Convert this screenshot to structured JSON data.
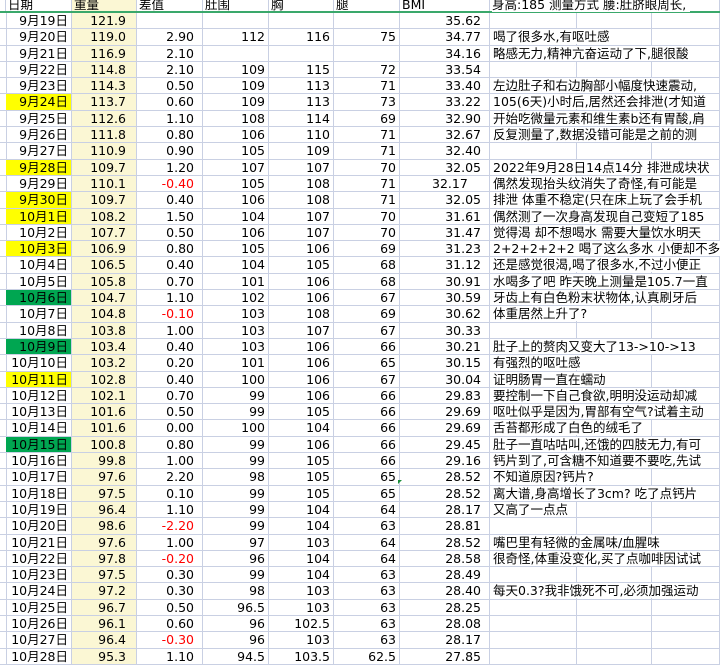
{
  "header": {
    "date": "日期",
    "weight": "重量",
    "diff": "差值",
    "belly": "肚围",
    "chest": "胸",
    "leg": "腿",
    "bmi": "BMI",
    "notes": "身高:185  测量方式  腰:肚脐眼周长,"
  },
  "colors": {
    "yellow": "#ffff00",
    "green": "#00a651",
    "weight_col": "#fbf7d4",
    "negative": "#ff0000"
  },
  "rows": [
    {
      "date": "9月19日",
      "weight": "121.9",
      "diff": "",
      "belly": "",
      "chest": "",
      "leg": "",
      "bmi": "35.62",
      "note": "",
      "hl": ""
    },
    {
      "date": "9月20日",
      "weight": "119.0",
      "diff": "2.90",
      "belly": "112",
      "chest": "116",
      "leg": "75",
      "bmi": "34.77",
      "note": "喝了很多水,有呕吐感",
      "hl": ""
    },
    {
      "date": "9月21日",
      "weight": "116.9",
      "diff": "2.10",
      "belly": "",
      "chest": "",
      "leg": "",
      "bmi": "34.16",
      "note": "略感无力,精神亢奋运动了下,腿很酸",
      "hl": ""
    },
    {
      "date": "9月22日",
      "weight": "114.8",
      "diff": "2.10",
      "belly": "109",
      "chest": "115",
      "leg": "72",
      "bmi": "33.54",
      "note": "",
      "hl": ""
    },
    {
      "date": "9月23日",
      "weight": "114.3",
      "diff": "0.50",
      "belly": "109",
      "chest": "113",
      "leg": "71",
      "bmi": "33.40",
      "note": "左边肚子和右边胸部小幅度快速震动,",
      "hl": ""
    },
    {
      "date": "9月24日",
      "weight": "113.7",
      "diff": "0.60",
      "belly": "109",
      "chest": "113",
      "leg": "73",
      "bmi": "33.22",
      "note": "105(6天)小时后,居然还会排泄(才知道",
      "hl": "yellow"
    },
    {
      "date": "9月25日",
      "weight": "112.6",
      "diff": "1.10",
      "belly": "108",
      "chest": "114",
      "leg": "69",
      "bmi": "32.90",
      "note": "开始吃微量元素和维生素b还有胃酸,肩",
      "hl": ""
    },
    {
      "date": "9月26日",
      "weight": "111.8",
      "diff": "0.80",
      "belly": "106",
      "chest": "110",
      "leg": "71",
      "bmi": "32.67",
      "note": "反复测量了,数据没错可能是之前的测",
      "hl": ""
    },
    {
      "date": "9月27日",
      "weight": "110.9",
      "diff": "0.90",
      "belly": "105",
      "chest": "109",
      "leg": "71",
      "bmi": "32.40",
      "note": "",
      "hl": ""
    },
    {
      "date": "9月28日",
      "weight": "109.7",
      "diff": "1.20",
      "belly": "107",
      "chest": "107",
      "leg": "70",
      "bmi": "32.05",
      "note": "2022年9月28日14点14分  排泄成块状",
      "hl": "yellow"
    },
    {
      "date": "9月29日",
      "weight": "110.1",
      "diff": "-0.40",
      "belly": "105",
      "chest": "108",
      "leg": "71",
      "bmi": "32.17",
      "note": "偶然发现抬头纹消失了奇怪,有可能是",
      "hl": "",
      "bmi_text": true
    },
    {
      "date": "9月30日",
      "weight": "109.7",
      "diff": "0.40",
      "belly": "106",
      "chest": "108",
      "leg": "71",
      "bmi": "32.05",
      "note": "排泄  体重不稳定(只在床上玩了会手机",
      "hl": "yellow"
    },
    {
      "date": "10月1日",
      "weight": "108.2",
      "diff": "1.50",
      "belly": "104",
      "chest": "107",
      "leg": "70",
      "bmi": "31.61",
      "note": "偶然测了一次身高发现自己变短了185",
      "hl": "yellow"
    },
    {
      "date": "10月2日",
      "weight": "107.7",
      "diff": "0.50",
      "belly": "106",
      "chest": "107",
      "leg": "70",
      "bmi": "31.47",
      "note": "觉得渴  却不想喝水  需要大量饮水明天",
      "hl": ""
    },
    {
      "date": "10月3日",
      "weight": "106.9",
      "diff": "0.80",
      "belly": "105",
      "chest": "106",
      "leg": "69",
      "bmi": "31.23",
      "note": "2+2+2+2+2  喝了这么多水  小便却不多",
      "hl": "yellow"
    },
    {
      "date": "10月4日",
      "weight": "106.5",
      "diff": "0.40",
      "belly": "104",
      "chest": "105",
      "leg": "68",
      "bmi": "31.12",
      "note": "还是感觉很渴,喝了很多水,不过小便正",
      "hl": ""
    },
    {
      "date": "10月5日",
      "weight": "105.8",
      "diff": "0.70",
      "belly": "101",
      "chest": "106",
      "leg": "68",
      "bmi": "30.91",
      "note": "水喝多了吧  昨天晚上测量是105.7一直",
      "hl": ""
    },
    {
      "date": "10月6日",
      "weight": "104.7",
      "diff": "1.10",
      "belly": "102",
      "chest": "106",
      "leg": "67",
      "bmi": "30.59",
      "note": "牙齿上有白色粉末状物体,认真刷牙后",
      "hl": "green"
    },
    {
      "date": "10月7日",
      "weight": "104.8",
      "diff": "-0.10",
      "belly": "103",
      "chest": "108",
      "leg": "69",
      "bmi": "30.62",
      "note": "体重居然上升了?",
      "hl": ""
    },
    {
      "date": "10月8日",
      "weight": "103.8",
      "diff": "1.00",
      "belly": "103",
      "chest": "107",
      "leg": "67",
      "bmi": "30.33",
      "note": "",
      "hl": ""
    },
    {
      "date": "10月9日",
      "weight": "103.4",
      "diff": "0.40",
      "belly": "103",
      "chest": "106",
      "leg": "66",
      "bmi": "30.21",
      "note": "肚子上的赘肉又变大了13->10->13",
      "hl": "green"
    },
    {
      "date": "10月10日",
      "weight": "103.2",
      "diff": "0.20",
      "belly": "101",
      "chest": "106",
      "leg": "65",
      "bmi": "30.15",
      "note": "有强烈的呕吐感",
      "hl": ""
    },
    {
      "date": "10月11日",
      "weight": "102.8",
      "diff": "0.40",
      "belly": "100",
      "chest": "106",
      "leg": "67",
      "bmi": "30.04",
      "note": "证明肠胃一直在蠕动",
      "hl": "yellow"
    },
    {
      "date": "10月12日",
      "weight": "102.1",
      "diff": "0.70",
      "belly": "99",
      "chest": "106",
      "leg": "66",
      "bmi": "29.83",
      "note": "要控制一下自己食欲,明明没运动却减",
      "hl": ""
    },
    {
      "date": "10月13日",
      "weight": "101.6",
      "diff": "0.50",
      "belly": "99",
      "chest": "105",
      "leg": "66",
      "bmi": "29.69",
      "note": "呕吐似乎是因为,胃部有空气?试着主动",
      "hl": ""
    },
    {
      "date": "10月14日",
      "weight": "101.6",
      "diff": "0.00",
      "belly": "100",
      "chest": "104",
      "leg": "66",
      "bmi": "29.69",
      "note": "舌苔都形成了白色的绒毛了",
      "hl": ""
    },
    {
      "date": "10月15日",
      "weight": "100.8",
      "diff": "0.80",
      "belly": "99",
      "chest": "106",
      "leg": "66",
      "bmi": "29.45",
      "note": "肚子一直咕咕叫,还饿的四肢无力,有可",
      "hl": "green"
    },
    {
      "date": "10月16日",
      "weight": "99.8",
      "diff": "1.00",
      "belly": "99",
      "chest": "105",
      "leg": "66",
      "bmi": "29.16",
      "note": "钙片到了,可含糖不知道要不要吃,先试",
      "hl": ""
    },
    {
      "date": "10月17日",
      "weight": "97.6",
      "diff": "2.20",
      "belly": "98",
      "chest": "105",
      "leg": "65",
      "bmi": "28.52",
      "note": "不知道原因?钙片?",
      "hl": ""
    },
    {
      "date": "10月18日",
      "weight": "97.5",
      "diff": "0.10",
      "belly": "99",
      "chest": "105",
      "leg": "65",
      "bmi": "28.52",
      "note": "离大谱,身高增长了3cm? 吃了点钙片",
      "hl": ""
    },
    {
      "date": "10月19日",
      "weight": "96.4",
      "diff": "1.10",
      "belly": "99",
      "chest": "104",
      "leg": "64",
      "bmi": "28.17",
      "note": "又高了一点点",
      "hl": ""
    },
    {
      "date": "10月20日",
      "weight": "98.6",
      "diff": "-2.20",
      "belly": "99",
      "chest": "104",
      "leg": "63",
      "bmi": "28.81",
      "note": "",
      "hl": ""
    },
    {
      "date": "10月21日",
      "weight": "97.6",
      "diff": "1.00",
      "belly": "97",
      "chest": "103",
      "leg": "64",
      "bmi": "28.52",
      "note": "嘴巴里有轻微的金属味/血腥味",
      "hl": ""
    },
    {
      "date": "10月22日",
      "weight": "97.8",
      "diff": "-0.20",
      "belly": "96",
      "chest": "104",
      "leg": "64",
      "bmi": "28.58",
      "note": "很奇怪,体重没变化,买了点咖啡因试试",
      "hl": ""
    },
    {
      "date": "10月23日",
      "weight": "97.5",
      "diff": "0.30",
      "belly": "99",
      "chest": "104",
      "leg": "63",
      "bmi": "28.49",
      "note": "",
      "hl": ""
    },
    {
      "date": "10月24日",
      "weight": "97.2",
      "diff": "0.30",
      "belly": "98",
      "chest": "103",
      "leg": "63",
      "bmi": "28.40",
      "note": "每天0.3?我非饿死不可,必须加强运动",
      "hl": ""
    },
    {
      "date": "10月25日",
      "weight": "96.7",
      "diff": "0.50",
      "belly": "96.5",
      "chest": "103",
      "leg": "63",
      "bmi": "28.25",
      "note": "",
      "hl": ""
    },
    {
      "date": "10月26日",
      "weight": "96.1",
      "diff": "0.60",
      "belly": "96",
      "chest": "102.5",
      "leg": "63",
      "bmi": "28.08",
      "note": "",
      "hl": ""
    },
    {
      "date": "10月27日",
      "weight": "96.4",
      "diff": "-0.30",
      "belly": "96",
      "chest": "103",
      "leg": "63",
      "bmi": "28.17",
      "note": "",
      "hl": ""
    },
    {
      "date": "10月28日",
      "weight": "95.3",
      "diff": "1.10",
      "belly": "94.5",
      "chest": "103.5",
      "leg": "62.5",
      "bmi": "27.85",
      "note": "",
      "hl": ""
    }
  ]
}
